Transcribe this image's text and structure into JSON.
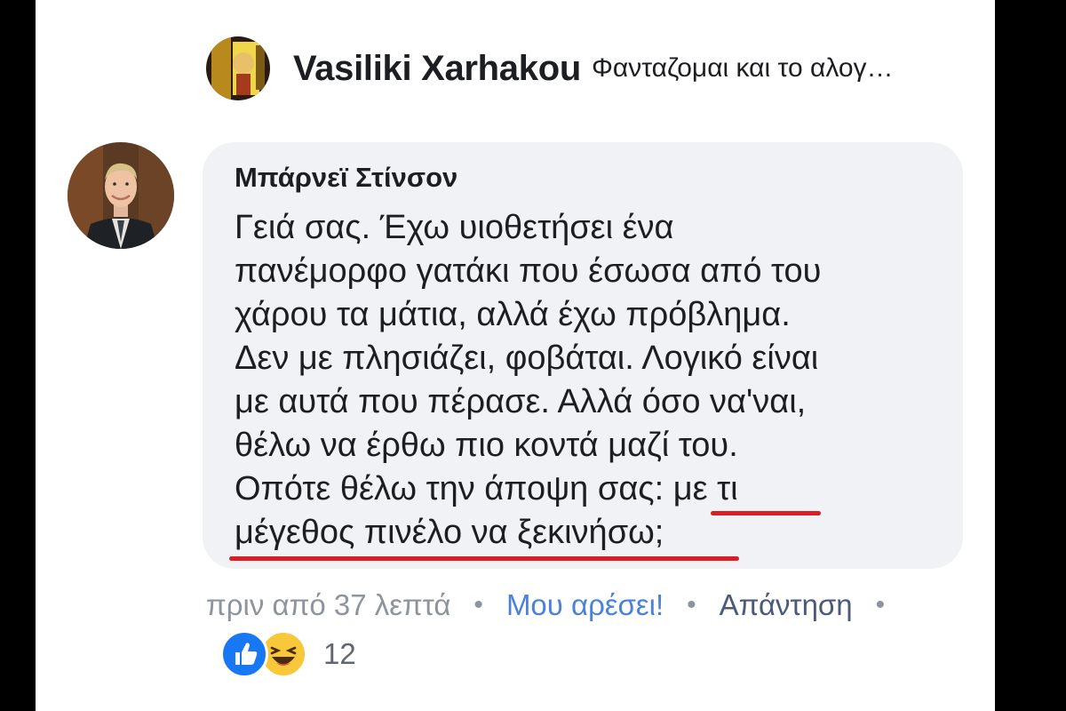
{
  "reply": {
    "author": "Vasiliki Xarhakou",
    "snippet": "Φανταζομαι και το αλογ…",
    "avatar_icon": "profile-photo-icon"
  },
  "comment": {
    "author": "Μπάρνεϊ Στίνσον",
    "avatar_icon": "profile-photo-icon",
    "lines": [
      "Γειά σας. Έχω υιοθετήσει ένα",
      "πανέμορφο γατάκι που έσωσα από του",
      "χάρου τα μάτια, αλλά έχω πρόβλημα.",
      "Δεν με πλησιάζει, φοβάται. Λογικό είναι",
      "με αυτά που πέρασε. Αλλά όσο να'ναι,",
      "θέλω να έρθω πιο κοντά μαζί του.",
      "Οπότε θέλω την άποψη σας: με τι",
      "μέγεθος πινέλο να ξεκινήσω;"
    ],
    "highlight_color": "#d81f26"
  },
  "meta": {
    "time": "πριν από 37 λεπτά",
    "separator": "•",
    "like_label": "Μου αρέσει!",
    "reply_label": "Απάντηση"
  },
  "reactions": {
    "icons": [
      "like-reaction-icon",
      "haha-reaction-icon"
    ],
    "count": "12",
    "like_color": "#1877f2",
    "haha_color": "#f7c93a"
  }
}
